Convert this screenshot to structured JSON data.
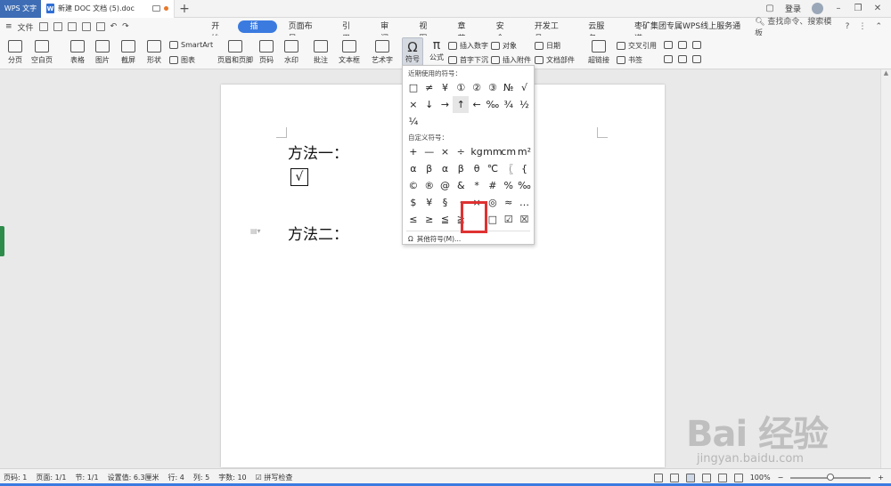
{
  "titlebar": {
    "app_name": "WPS 文字",
    "doc_tab": "新建 DOC 文档 (5).doc",
    "new_tab": "+",
    "login": "登录"
  },
  "menubar": {
    "file": "文件",
    "tabs": [
      "开始",
      "插入",
      "页面布局",
      "引用",
      "审阅",
      "视图",
      "章节",
      "安全",
      "开发工具",
      "云服务",
      "枣矿集团专属WPS线上服务通道"
    ],
    "active_tab": "插入",
    "search": "查找命令、搜索模板"
  },
  "ribbon": {
    "page_break": "分页",
    "blank_page": "空白页",
    "table": "表格",
    "picture": "图片",
    "screenshot": "截屏",
    "shape": "形状",
    "smartart": "SmartArt",
    "chart": "图表",
    "header_footer": "页眉和页脚",
    "page_number": "页码",
    "watermark": "水印",
    "comment": "批注",
    "textbox": "文本框",
    "wordart": "艺术字",
    "symbol": "符号",
    "formula": "公式",
    "insert_number": "插入数字",
    "drop_cap": "首字下沉",
    "object": "对象",
    "attachment": "插入附件",
    "date": "日期",
    "doc_parts": "文档部件",
    "hyperlink": "超链接",
    "cross_ref": "交叉引用",
    "bookmark": "书签"
  },
  "document": {
    "method1": "方法一：",
    "checkbox_char": "√",
    "method2": "方法二："
  },
  "symbol_panel": {
    "recent_label": "近期使用的符号：",
    "recent": [
      "□",
      "≠",
      "¥",
      "①",
      "②",
      "③",
      "№",
      "√",
      "×",
      "↓",
      "→",
      "↑",
      "←",
      "‰",
      "¾",
      "½",
      "¼"
    ],
    "custom_label": "自定义符号：",
    "custom": [
      "+",
      "—",
      "×",
      "÷",
      "kg",
      "mm",
      "cm",
      "m²",
      "α",
      "β",
      "α",
      "β",
      "θ",
      "℃",
      "〖",
      "{",
      "©",
      "®",
      "@",
      "&",
      "*",
      "#",
      "%",
      "‰",
      "$",
      "¥",
      "§",
      "·",
      "×",
      "◎",
      "≈",
      "…",
      "≤",
      "≥",
      "≦",
      "≧",
      "",
      "□",
      "☑",
      "☒"
    ],
    "more_label": "其他符号(M)..."
  },
  "statusbar": {
    "page_num": "页码: 1",
    "pages": "页面: 1/1",
    "section": "节: 1/1",
    "setting": "设置值: 6.3厘米",
    "row": "行: 4",
    "col": "列: 5",
    "words": "字数: 10",
    "spell": "拼写检查",
    "zoom": "100%",
    "zoom_minus": "−",
    "zoom_plus": "+"
  },
  "watermark": {
    "main": "Bai 经验",
    "sub": "jingyan.baidu.com"
  },
  "colors": {
    "accent": "#3b7be0",
    "app_tab": "#3e6db5",
    "highlight": "#e03131"
  }
}
